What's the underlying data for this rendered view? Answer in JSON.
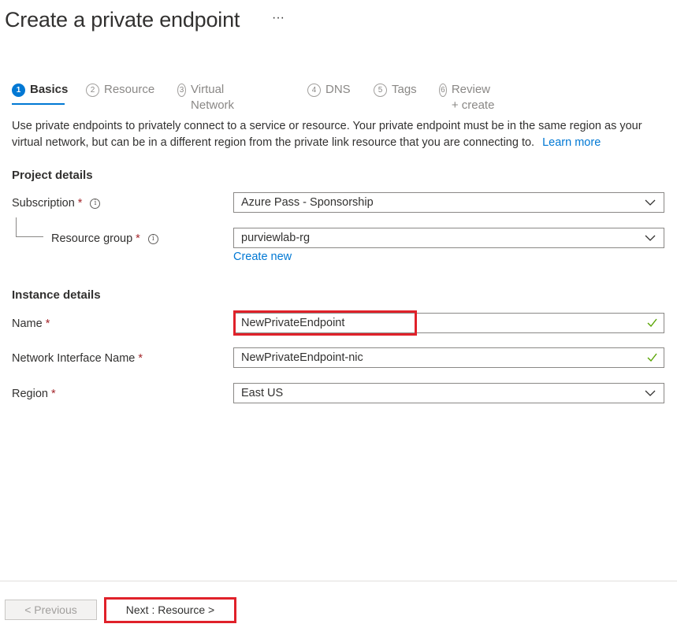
{
  "header": {
    "title": "Create a private endpoint",
    "more": "···"
  },
  "steps": [
    {
      "num": "1",
      "label": "Basics"
    },
    {
      "num": "2",
      "label": "Resource"
    },
    {
      "num": "3",
      "label": "Virtual Network"
    },
    {
      "num": "4",
      "label": "DNS"
    },
    {
      "num": "5",
      "label": "Tags"
    },
    {
      "num": "6",
      "label": "Review + create"
    }
  ],
  "intro": {
    "text": "Use private endpoints to privately connect to a service or resource. Your private endpoint must be in the same region as your virtual network, but can be in a different region from the private link resource that you are connecting to.",
    "learn_more": "Learn more"
  },
  "project_details": {
    "heading": "Project details",
    "subscription": {
      "label": "Subscription",
      "value": "Azure Pass - Sponsorship"
    },
    "resource_group": {
      "label": "Resource group",
      "value": "purviewlab-rg",
      "create_new": "Create new"
    }
  },
  "instance_details": {
    "heading": "Instance details",
    "name": {
      "label": "Name",
      "value": "NewPrivateEndpoint"
    },
    "nic_name": {
      "label": "Network Interface Name",
      "value": "NewPrivateEndpoint-nic"
    },
    "region": {
      "label": "Region",
      "value": "East US"
    }
  },
  "required_mark": "*",
  "info_glyph": "i",
  "footer": {
    "previous": "< Previous",
    "next": "Next : Resource >"
  },
  "colors": {
    "accent": "#0078d4",
    "required": "#a4262c",
    "valid": "#57a300",
    "highlight": "#e0212a"
  }
}
